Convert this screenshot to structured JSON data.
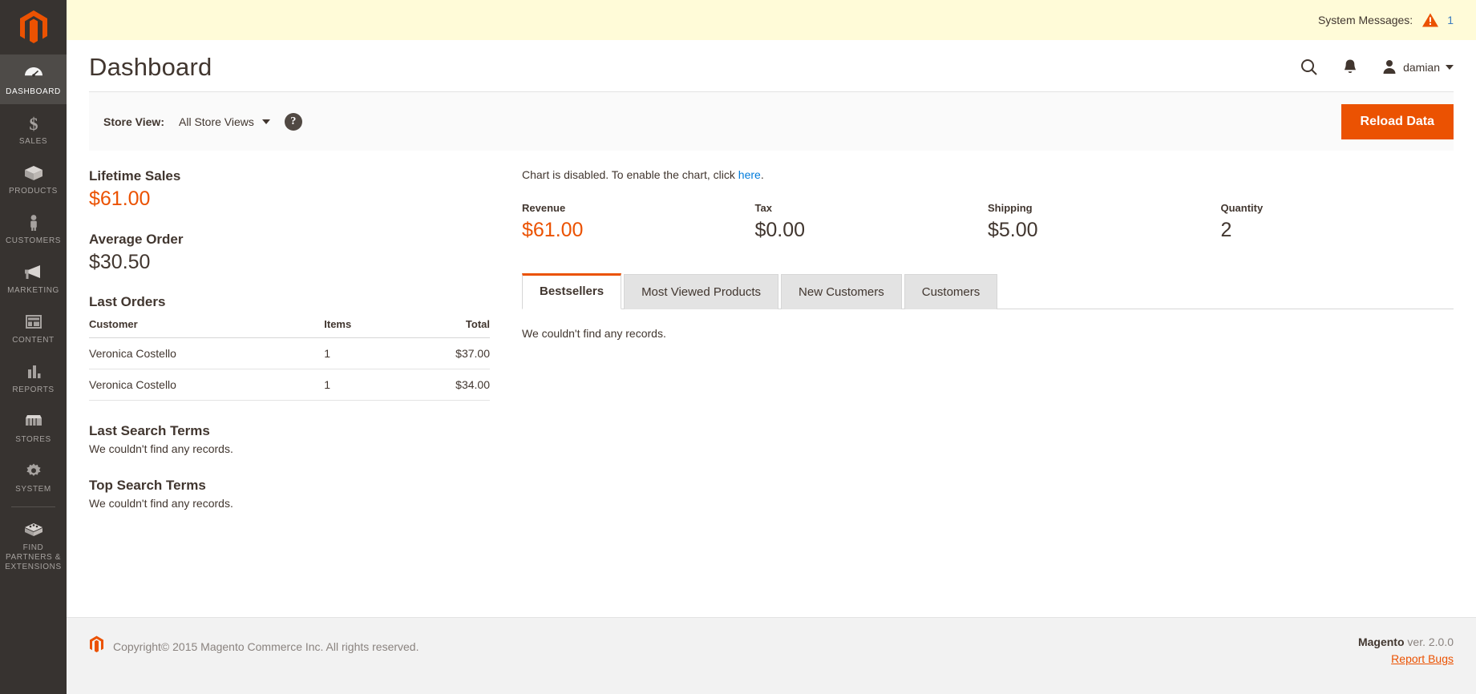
{
  "sidebar": {
    "logo": "magento-logo",
    "items": [
      {
        "label": "Dashboard",
        "icon": "gauge-icon",
        "active": true
      },
      {
        "label": "Sales",
        "icon": "dollar-icon",
        "active": false
      },
      {
        "label": "Products",
        "icon": "box-icon",
        "active": false
      },
      {
        "label": "Customers",
        "icon": "person-icon",
        "active": false
      },
      {
        "label": "Marketing",
        "icon": "megaphone-icon",
        "active": false
      },
      {
        "label": "Content",
        "icon": "layout-icon",
        "active": false
      },
      {
        "label": "Reports",
        "icon": "bar-chart-icon",
        "active": false
      },
      {
        "label": "Stores",
        "icon": "storefront-icon",
        "active": false
      },
      {
        "label": "System",
        "icon": "gear-icon",
        "active": false
      },
      {
        "label": "Find Partners & Extensions",
        "icon": "extension-icon",
        "active": false
      }
    ]
  },
  "system_messages": {
    "label": "System Messages:",
    "icon": "warning-triangle-icon",
    "count": "1"
  },
  "header": {
    "title": "Dashboard",
    "search_icon": "search-icon",
    "notifications_icon": "bell-icon",
    "user_icon": "user-avatar-icon",
    "user_name": "damian"
  },
  "toolbar": {
    "store_view_label": "Store View:",
    "store_view_value": "All Store Views",
    "help_icon": "question-mark-icon",
    "reload_label": "Reload Data"
  },
  "left_column": {
    "lifetime_sales_title": "Lifetime Sales",
    "lifetime_sales_value": "$61.00",
    "average_order_title": "Average Order",
    "average_order_value": "$30.50",
    "last_orders_title": "Last Orders",
    "orders_columns": [
      "Customer",
      "Items",
      "Total"
    ],
    "orders_rows": [
      {
        "customer": "Veronica Costello",
        "items": "1",
        "total": "$37.00"
      },
      {
        "customer": "Veronica Costello",
        "items": "1",
        "total": "$34.00"
      }
    ],
    "last_search_terms_title": "Last Search Terms",
    "last_search_terms_empty": "We couldn't find any records.",
    "top_search_terms_title": "Top Search Terms",
    "top_search_terms_empty": "We couldn't find any records."
  },
  "right_column": {
    "chart_note_prefix": "Chart is disabled. To enable the chart, click ",
    "chart_note_link": "here",
    "chart_note_suffix": ".",
    "kpis": [
      {
        "label": "Revenue",
        "value": "$61.00",
        "accent": true
      },
      {
        "label": "Tax",
        "value": "$0.00",
        "accent": false
      },
      {
        "label": "Shipping",
        "value": "$5.00",
        "accent": false
      },
      {
        "label": "Quantity",
        "value": "2",
        "accent": false
      }
    ],
    "tabs": [
      {
        "label": "Bestsellers",
        "active": true
      },
      {
        "label": "Most Viewed Products",
        "active": false
      },
      {
        "label": "New Customers",
        "active": false
      },
      {
        "label": "Customers",
        "active": false
      }
    ],
    "tab_empty_message": "We couldn't find any records."
  },
  "footer": {
    "logo": "magento-logo",
    "copyright": "Copyright© 2015 Magento Commerce Inc. All rights reserved.",
    "product_name": "Magento",
    "version": " ver. 2.0.0",
    "report_bugs": "Report Bugs"
  },
  "colors": {
    "accent": "#eb5202",
    "sidebar_bg": "#373330",
    "sidebar_active": "#4e4b48",
    "link": "#007bdb",
    "sysmsg_bg": "#fffbd8",
    "text": "#41362f"
  }
}
